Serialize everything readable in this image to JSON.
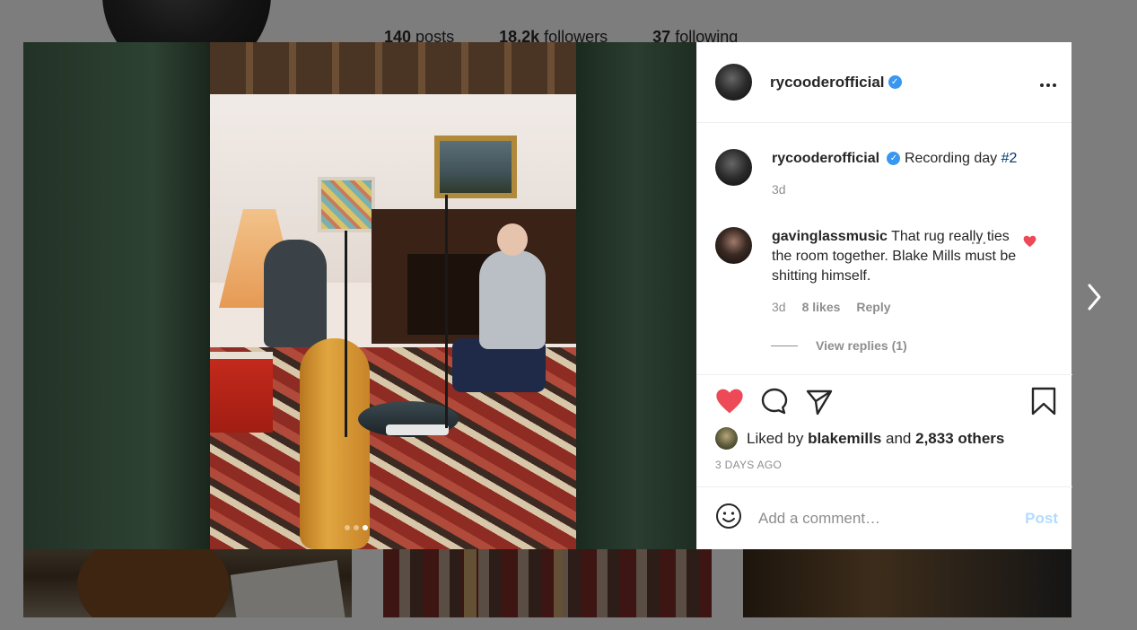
{
  "background": {
    "stats": [
      {
        "value": "140",
        "label": " posts"
      },
      {
        "value": "18.2k",
        "label": " followers"
      },
      {
        "value": "37",
        "label": " following"
      }
    ]
  },
  "post": {
    "author": "rycooderofficial",
    "verified": true,
    "carousel": {
      "count": 3,
      "active_index": 2
    },
    "caption": {
      "username": "rycooderofficial",
      "text": "Recording day ",
      "hashtag": "#2",
      "time": "3d"
    },
    "comments": [
      {
        "username": "gavinglassmusic",
        "text": "That rug really ties the room together. Blake Mills must be shitting himself.",
        "time": "3d",
        "likes": "8 likes",
        "reply_label": "Reply",
        "liked": true,
        "view_replies": "View replies (1)"
      }
    ],
    "likes": {
      "prefix": "Liked by ",
      "user": "blakemills",
      "joiner": " and ",
      "others": "2,833 others"
    },
    "timestamp": "3 DAYS AGO",
    "add_comment": {
      "placeholder": "Add a comment…",
      "post_label": "Post"
    }
  },
  "colors": {
    "accent": "#3897f0",
    "heart": "#ed4956",
    "post_disabled": "#b3dbff",
    "hashtag": "#00376b"
  },
  "icons": [
    "chevron-left-icon",
    "chevron-right-icon",
    "more-icon",
    "verified-icon",
    "heart-icon",
    "comment-icon",
    "share-icon",
    "bookmark-icon",
    "emoji-icon"
  ]
}
